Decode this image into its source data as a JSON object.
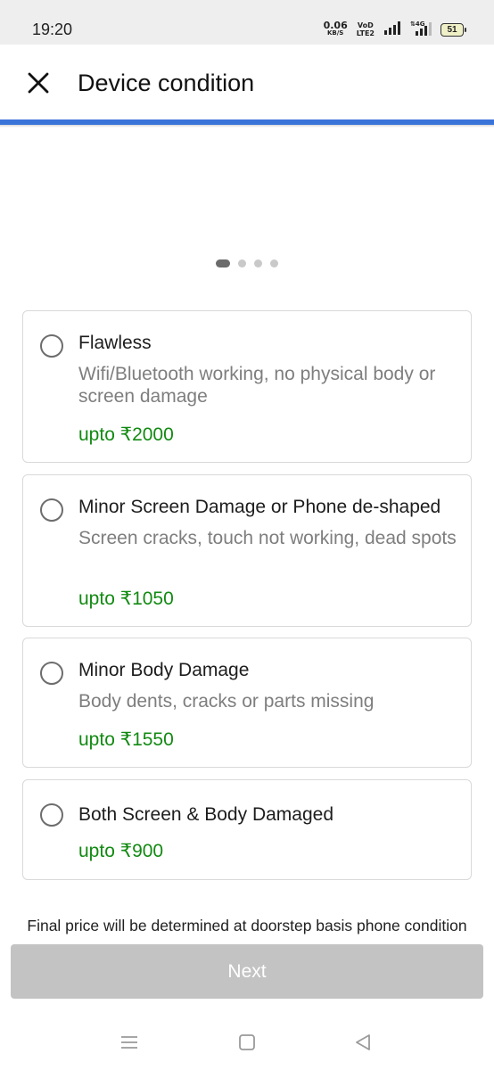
{
  "status_bar": {
    "time": "19:20",
    "net_speed_value": "0.06",
    "net_speed_unit": "KB/S",
    "volte_top": "VoD",
    "volte_bottom": "LTE2",
    "battery_level": "51"
  },
  "header": {
    "title": "Device condition",
    "close_icon": "close-icon"
  },
  "carousel": {
    "dot_count": 4,
    "active_index": 0
  },
  "options": [
    {
      "title": "Flawless",
      "description": "Wifi/Bluetooth working, no physical body or screen damage",
      "price": "upto ₹2000"
    },
    {
      "title": "Minor Screen Damage or Phone de-shaped",
      "description": "Screen cracks, touch not working, dead spots",
      "price": "upto ₹1050"
    },
    {
      "title": "Minor Body Damage",
      "description": "Body dents, cracks or parts missing",
      "price": "upto ₹1550"
    },
    {
      "title": "Both Screen & Body Damaged",
      "description": "",
      "price": "upto ₹900"
    }
  ],
  "footer": {
    "note": "Final price will be determined at doorstep basis phone condition",
    "next_label": "Next"
  },
  "colors": {
    "accent": "#3a74d8",
    "price": "#128a12",
    "disabled_button": "#c3c3c3"
  },
  "nav_icons": [
    "menu-icon",
    "home-square-icon",
    "back-triangle-icon"
  ]
}
